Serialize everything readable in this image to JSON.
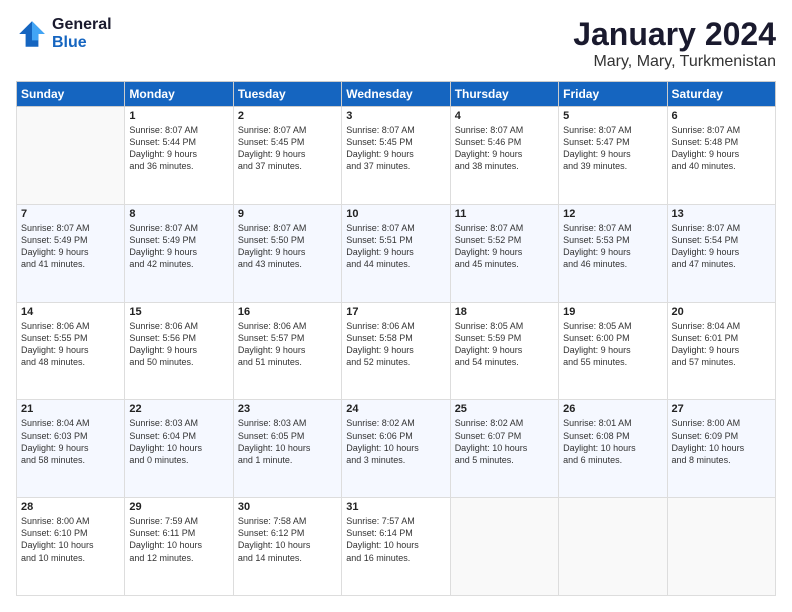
{
  "logo": {
    "line1": "General",
    "line2": "Blue"
  },
  "header": {
    "month": "January 2024",
    "location": "Mary, Mary, Turkmenistan"
  },
  "weekdays": [
    "Sunday",
    "Monday",
    "Tuesday",
    "Wednesday",
    "Thursday",
    "Friday",
    "Saturday"
  ],
  "weeks": [
    [
      {
        "day": "",
        "sunrise": "",
        "sunset": "",
        "daylight": ""
      },
      {
        "day": "1",
        "sunrise": "Sunrise: 8:07 AM",
        "sunset": "Sunset: 5:44 PM",
        "daylight": "Daylight: 9 hours and 36 minutes."
      },
      {
        "day": "2",
        "sunrise": "Sunrise: 8:07 AM",
        "sunset": "Sunset: 5:45 PM",
        "daylight": "Daylight: 9 hours and 37 minutes."
      },
      {
        "day": "3",
        "sunrise": "Sunrise: 8:07 AM",
        "sunset": "Sunset: 5:45 PM",
        "daylight": "Daylight: 9 hours and 37 minutes."
      },
      {
        "day": "4",
        "sunrise": "Sunrise: 8:07 AM",
        "sunset": "Sunset: 5:46 PM",
        "daylight": "Daylight: 9 hours and 38 minutes."
      },
      {
        "day": "5",
        "sunrise": "Sunrise: 8:07 AM",
        "sunset": "Sunset: 5:47 PM",
        "daylight": "Daylight: 9 hours and 39 minutes."
      },
      {
        "day": "6",
        "sunrise": "Sunrise: 8:07 AM",
        "sunset": "Sunset: 5:48 PM",
        "daylight": "Daylight: 9 hours and 40 minutes."
      }
    ],
    [
      {
        "day": "7",
        "sunrise": "Sunrise: 8:07 AM",
        "sunset": "Sunset: 5:49 PM",
        "daylight": "Daylight: 9 hours and 41 minutes."
      },
      {
        "day": "8",
        "sunrise": "Sunrise: 8:07 AM",
        "sunset": "Sunset: 5:49 PM",
        "daylight": "Daylight: 9 hours and 42 minutes."
      },
      {
        "day": "9",
        "sunrise": "Sunrise: 8:07 AM",
        "sunset": "Sunset: 5:50 PM",
        "daylight": "Daylight: 9 hours and 43 minutes."
      },
      {
        "day": "10",
        "sunrise": "Sunrise: 8:07 AM",
        "sunset": "Sunset: 5:51 PM",
        "daylight": "Daylight: 9 hours and 44 minutes."
      },
      {
        "day": "11",
        "sunrise": "Sunrise: 8:07 AM",
        "sunset": "Sunset: 5:52 PM",
        "daylight": "Daylight: 9 hours and 45 minutes."
      },
      {
        "day": "12",
        "sunrise": "Sunrise: 8:07 AM",
        "sunset": "Sunset: 5:53 PM",
        "daylight": "Daylight: 9 hours and 46 minutes."
      },
      {
        "day": "13",
        "sunrise": "Sunrise: 8:07 AM",
        "sunset": "Sunset: 5:54 PM",
        "daylight": "Daylight: 9 hours and 47 minutes."
      }
    ],
    [
      {
        "day": "14",
        "sunrise": "Sunrise: 8:06 AM",
        "sunset": "Sunset: 5:55 PM",
        "daylight": "Daylight: 9 hours and 48 minutes."
      },
      {
        "day": "15",
        "sunrise": "Sunrise: 8:06 AM",
        "sunset": "Sunset: 5:56 PM",
        "daylight": "Daylight: 9 hours and 50 minutes."
      },
      {
        "day": "16",
        "sunrise": "Sunrise: 8:06 AM",
        "sunset": "Sunset: 5:57 PM",
        "daylight": "Daylight: 9 hours and 51 minutes."
      },
      {
        "day": "17",
        "sunrise": "Sunrise: 8:06 AM",
        "sunset": "Sunset: 5:58 PM",
        "daylight": "Daylight: 9 hours and 52 minutes."
      },
      {
        "day": "18",
        "sunrise": "Sunrise: 8:05 AM",
        "sunset": "Sunset: 5:59 PM",
        "daylight": "Daylight: 9 hours and 54 minutes."
      },
      {
        "day": "19",
        "sunrise": "Sunrise: 8:05 AM",
        "sunset": "Sunset: 6:00 PM",
        "daylight": "Daylight: 9 hours and 55 minutes."
      },
      {
        "day": "20",
        "sunrise": "Sunrise: 8:04 AM",
        "sunset": "Sunset: 6:01 PM",
        "daylight": "Daylight: 9 hours and 57 minutes."
      }
    ],
    [
      {
        "day": "21",
        "sunrise": "Sunrise: 8:04 AM",
        "sunset": "Sunset: 6:03 PM",
        "daylight": "Daylight: 9 hours and 58 minutes."
      },
      {
        "day": "22",
        "sunrise": "Sunrise: 8:03 AM",
        "sunset": "Sunset: 6:04 PM",
        "daylight": "Daylight: 10 hours and 0 minutes."
      },
      {
        "day": "23",
        "sunrise": "Sunrise: 8:03 AM",
        "sunset": "Sunset: 6:05 PM",
        "daylight": "Daylight: 10 hours and 1 minute."
      },
      {
        "day": "24",
        "sunrise": "Sunrise: 8:02 AM",
        "sunset": "Sunset: 6:06 PM",
        "daylight": "Daylight: 10 hours and 3 minutes."
      },
      {
        "day": "25",
        "sunrise": "Sunrise: 8:02 AM",
        "sunset": "Sunset: 6:07 PM",
        "daylight": "Daylight: 10 hours and 5 minutes."
      },
      {
        "day": "26",
        "sunrise": "Sunrise: 8:01 AM",
        "sunset": "Sunset: 6:08 PM",
        "daylight": "Daylight: 10 hours and 6 minutes."
      },
      {
        "day": "27",
        "sunrise": "Sunrise: 8:00 AM",
        "sunset": "Sunset: 6:09 PM",
        "daylight": "Daylight: 10 hours and 8 minutes."
      }
    ],
    [
      {
        "day": "28",
        "sunrise": "Sunrise: 8:00 AM",
        "sunset": "Sunset: 6:10 PM",
        "daylight": "Daylight: 10 hours and 10 minutes."
      },
      {
        "day": "29",
        "sunrise": "Sunrise: 7:59 AM",
        "sunset": "Sunset: 6:11 PM",
        "daylight": "Daylight: 10 hours and 12 minutes."
      },
      {
        "day": "30",
        "sunrise": "Sunrise: 7:58 AM",
        "sunset": "Sunset: 6:12 PM",
        "daylight": "Daylight: 10 hours and 14 minutes."
      },
      {
        "day": "31",
        "sunrise": "Sunrise: 7:57 AM",
        "sunset": "Sunset: 6:14 PM",
        "daylight": "Daylight: 10 hours and 16 minutes."
      },
      {
        "day": "",
        "sunrise": "",
        "sunset": "",
        "daylight": ""
      },
      {
        "day": "",
        "sunrise": "",
        "sunset": "",
        "daylight": ""
      },
      {
        "day": "",
        "sunrise": "",
        "sunset": "",
        "daylight": ""
      }
    ]
  ]
}
